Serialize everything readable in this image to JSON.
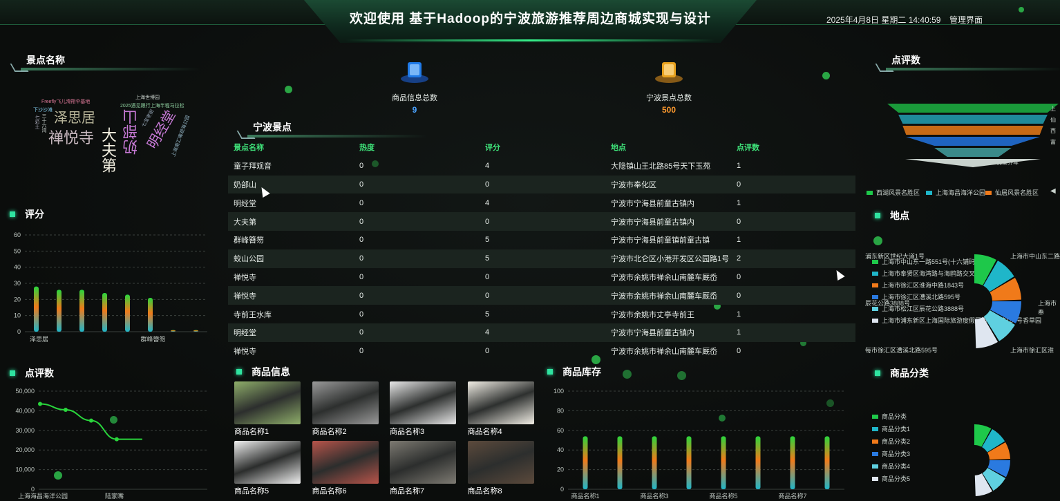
{
  "header": {
    "title": "欢迎使用 基于Hadoop的宁波旅游推荐周边商城实现与设计",
    "datetime": "2025年4月8日 星期二 14:40:59",
    "admin_label": "管理界面"
  },
  "sections": {
    "spot_names": "景点名称",
    "rating": "评分",
    "review_count_left": "点评数",
    "ningbo_spots": "宁波景点",
    "products": "商品信息",
    "inventory": "商品库存",
    "review_count_right": "点评数",
    "location": "地点",
    "categories": "商品分类"
  },
  "stats": [
    {
      "label": "商品信息总数",
      "value": "9",
      "color": "#4aa3ff"
    },
    {
      "label": "宁波景点总数",
      "value": "500",
      "color": "#ff9a2e"
    }
  ],
  "word_cloud": [
    {
      "text": "泽思居",
      "color": "#b8b59a"
    },
    {
      "text": "禅悦寺",
      "color": "#c9b9c0"
    },
    {
      "text": "大夫第",
      "color": "#f2efe0"
    },
    {
      "text": "奶部山",
      "color": "#c77ad6"
    },
    {
      "text": "明经堂",
      "color": "#c77ad6"
    },
    {
      "text": "上海世博园",
      "color": "#c9d2cd"
    },
    {
      "text": "2025遇见跟行上海半程马拉松",
      "color": "#8fd0a0"
    },
    {
      "text": "Freefly飞儿滑翔伞基地",
      "color": "#e07a9a"
    },
    {
      "text": "下沙沙滩",
      "color": "#7ac0e0"
    },
    {
      "text": "三十六湾",
      "color": "#c9d2cd"
    },
    {
      "text": "七彩土",
      "color": "#aab"
    },
    {
      "text": "上海南汇嘴观海公园",
      "color": "#8fb0c0"
    },
    {
      "text": "七宝老街",
      "color": "#9ab"
    }
  ],
  "table": {
    "headers": [
      "景点名称",
      "热度",
      "评分",
      "地点",
      "点评数"
    ],
    "rows": [
      [
        "童子拜观音",
        "0",
        "4",
        "大隐镇山王北路85号天下玉苑",
        "1"
      ],
      [
        "奶部山",
        "0",
        "0",
        "宁波市奉化区",
        "0"
      ],
      [
        "明经堂",
        "0",
        "4",
        "宁波市宁海县前童古镇内",
        "1"
      ],
      [
        "大夫第",
        "0",
        "0",
        "宁波市宁海县前童古镇内",
        "0"
      ],
      [
        "群峰簪笏",
        "0",
        "5",
        "宁波市宁海县前童镇前童古镇",
        "1"
      ],
      [
        "蛟山公园",
        "0",
        "5",
        "宁波市北仑区小港开发区公园路1号",
        "2"
      ],
      [
        "禅悦寺",
        "0",
        "0",
        "宁波市余姚市禅余山南麓车厩岙",
        "0"
      ],
      [
        "禅悦寺",
        "0",
        "0",
        "宁波市余姚市禅余山南麓车厩岙",
        "0"
      ],
      [
        "寺前王水库",
        "0",
        "5",
        "宁波市余姚市丈亭寺前王",
        "1"
      ],
      [
        "明经堂",
        "0",
        "4",
        "宁波市宁海县前童古镇内",
        "1"
      ],
      [
        "禅悦寺",
        "0",
        "0",
        "宁波市余姚市禅余山南麓车厩岙",
        "0"
      ]
    ]
  },
  "products": [
    {
      "name": "商品名称1",
      "color": "#8fae6a"
    },
    {
      "name": "商品名称2",
      "color": "#9a9a9a"
    },
    {
      "name": "商品名称3",
      "color": "#e8e8e8"
    },
    {
      "name": "商品名称4",
      "color": "#f2efe6"
    },
    {
      "name": "商品名称5",
      "color": "#f0f0f0"
    },
    {
      "name": "商品名称6",
      "color": "#b8544a"
    },
    {
      "name": "商品名称7",
      "color": "#7d7a72"
    },
    {
      "name": "商品名称8",
      "color": "#5c4a3c"
    }
  ],
  "legend_right_top": [
    {
      "name": "西湖风景名胜区",
      "color": "#1ec84a"
    },
    {
      "name": "上海海昌海洋公园",
      "color": "#1fb6c9"
    },
    {
      "name": "仙居风景名胜区",
      "color": "#f07a1a"
    }
  ],
  "location_legend": [
    {
      "name": "上海市中山东一路551号(十六铺码头)",
      "color": "#1ec84a"
    },
    {
      "name": "上海市奉贤区海湾路与海鸥路交叉口",
      "color": "#1fb6c9"
    },
    {
      "name": "上海市徐汇区淮海中路1843号",
      "color": "#f07a1a"
    },
    {
      "name": "上海市徐汇区漕溪北路595号",
      "color": "#2a7ae0"
    },
    {
      "name": "上海市松江区辰花公路3888号",
      "color": "#5fd0e0"
    },
    {
      "name": "上海市浦东新区上海国际旅游度假区申迪西路187号香草园",
      "color": "#dfe6f0"
    }
  ],
  "location_outer_labels": [
    "浦东新区世纪大道1号",
    "上海市中山东二路",
    "上海市奉",
    "辰花公路3888号",
    "每市徐汇区漕溪北路595号",
    "上海市徐汇区淮"
  ],
  "category_legend": [
    {
      "name": "商品分类",
      "color": "#1ec84a"
    },
    {
      "name": "商品分类1",
      "color": "#1fb6c9"
    },
    {
      "name": "商品分类2",
      "color": "#f07a1a"
    },
    {
      "name": "商品分类3",
      "color": "#2a7ae0"
    },
    {
      "name": "商品分类4",
      "color": "#5fd0e0"
    },
    {
      "name": "商品分类5",
      "color": "#dfe6f0"
    }
  ],
  "funnel_labels": [
    "上",
    "仙",
    "西",
    "富",
    "锦溪乔车"
  ],
  "chart_data": [
    {
      "id": "rating",
      "type": "bar",
      "ylim": [
        0,
        60
      ],
      "yticks": [
        0,
        10,
        20,
        30,
        40,
        50,
        60
      ],
      "x_labels_shown": [
        "泽思居",
        "群峰簪笏"
      ],
      "values": [
        28,
        26,
        26,
        24,
        23,
        21,
        1,
        1
      ],
      "grid": true
    },
    {
      "id": "review_count",
      "type": "line",
      "ylim": [
        0,
        50000
      ],
      "yticks": [
        "0",
        "10,000",
        "20,000",
        "30,000",
        "40,000",
        "50,000"
      ],
      "x_labels_shown": [
        "上海海昌海洋公园",
        "陆家嘴"
      ],
      "values": [
        43500,
        40500,
        35000,
        25500,
        25500
      ],
      "grid": true
    },
    {
      "id": "inventory",
      "type": "bar",
      "ylim": [
        0,
        100
      ],
      "yticks": [
        0,
        20,
        40,
        60,
        80,
        100
      ],
      "x_labels_shown": [
        "商品名称1",
        "商品名称3",
        "商品名称5",
        "商品名称7"
      ],
      "values": [
        54,
        54,
        54,
        54,
        54,
        54,
        54,
        54
      ],
      "grid": true
    },
    {
      "id": "location_share",
      "type": "pie",
      "values": [
        1,
        1,
        1,
        1,
        1,
        1
      ]
    },
    {
      "id": "category_share",
      "type": "pie",
      "values": [
        1,
        1,
        1,
        1,
        1,
        1
      ]
    },
    {
      "id": "review_funnel",
      "type": "bar",
      "values": [
        5,
        4,
        3,
        2,
        1
      ]
    }
  ]
}
